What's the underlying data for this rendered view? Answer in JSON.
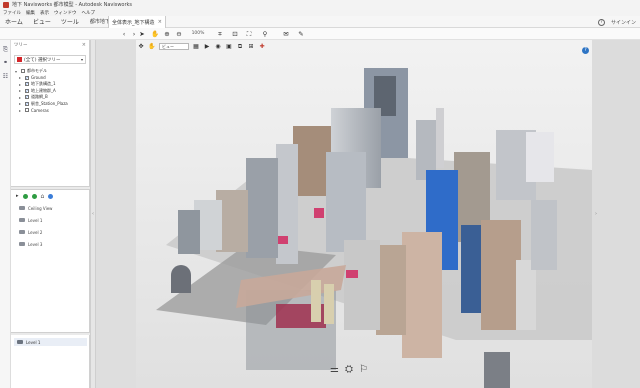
{
  "window": {
    "title": "地下 Navisworks 都市模型 - Autodesk Navisworks"
  },
  "menubar": {
    "items": [
      "ファイル",
      "編集",
      "表示",
      "ウィンドウ",
      "ヘルプ"
    ]
  },
  "mainbar": {
    "items": [
      "ホーム",
      "ビュー",
      "ツール"
    ],
    "file_tab": "都市地下モデル.nwd",
    "model_tab": "全体表示_地下構造",
    "help_label": "?",
    "signin_label": "サインイン"
  },
  "toolbar": {
    "zoom_value": "100%"
  },
  "left_panel": {
    "header": "ツリー",
    "select_label": "(全て) 選択ツリー",
    "tree": [
      {
        "label": "都市モデル",
        "level": 0,
        "checked": false
      },
      {
        "label": "Ground",
        "level": 1,
        "checked": true
      },
      {
        "label": "地下鉄構造_1",
        "level": 1,
        "checked": true
      },
      {
        "label": "地上建物群_A",
        "level": 1,
        "checked": true
      },
      {
        "label": "道路網_B",
        "level": 1,
        "checked": true
      },
      {
        "label": "駅舎_Station_Plaza",
        "level": 1,
        "checked": true
      },
      {
        "label": "Cameras",
        "level": 1,
        "checked": false
      }
    ],
    "views": [
      "Ceiling View",
      "Level 1",
      "Level 2",
      "Level 3"
    ],
    "layer": "Level 1"
  },
  "viewport": {
    "view_select": "ビュー"
  }
}
